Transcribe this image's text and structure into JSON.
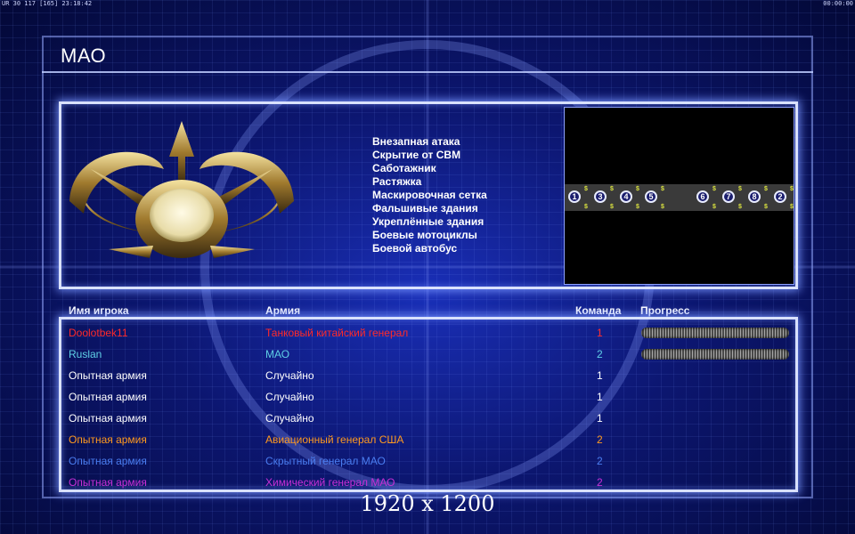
{
  "hud": {
    "left": "UR 30 117 [165] 23:18:42",
    "right": "00:00:00"
  },
  "screen_title": "МАО",
  "rules": [
    "Внезапная атака",
    "Скрытие от СВМ",
    "Саботажник",
    "Растяжка",
    "Маскировочная сетка",
    "Фальшивые здания",
    "Укреплённые здания",
    "Боевые мотоциклы",
    "Боевой автобус"
  ],
  "minimap": {
    "slots": [
      "1",
      "3",
      "4",
      "5",
      "6",
      "7",
      "8",
      "2"
    ],
    "cash_icon": "dollar-sign"
  },
  "columns": {
    "player": "Имя игрока",
    "army": "Армия",
    "team": "Команда",
    "progress": "Прогресс"
  },
  "players": [
    {
      "name": "Doolotbek11",
      "army": "Танковый китайский генерал",
      "team": "1",
      "color": "#ff2a2a",
      "progress": 1.0
    },
    {
      "name": "Ruslan",
      "army": "МАО",
      "team": "2",
      "color": "#5fd0e6",
      "progress": 1.0
    },
    {
      "name": "Опытная армия",
      "army": "Случайно",
      "team": "1",
      "color": "#ffffff",
      "progress": 0
    },
    {
      "name": "Опытная армия",
      "army": "Случайно",
      "team": "1",
      "color": "#ffffff",
      "progress": 0
    },
    {
      "name": "Опытная армия",
      "army": "Случайно",
      "team": "1",
      "color": "#ffffff",
      "progress": 0
    },
    {
      "name": "Опытная армия",
      "army": "Авиационный генерал США",
      "team": "2",
      "color": "#ff9a1f",
      "progress": 0
    },
    {
      "name": "Опытная армия",
      "army": "Скрытный генерал МАО",
      "team": "2",
      "color": "#4a7df0",
      "progress": 0
    },
    {
      "name": "Опытная армия",
      "army": "Химический генерал МАО",
      "team": "2",
      "color": "#c82fd6",
      "progress": 0
    }
  ],
  "resolution_label": "1920 x 1200",
  "colors": {
    "accent": "#d9e1ff",
    "background": "#0c1670"
  }
}
